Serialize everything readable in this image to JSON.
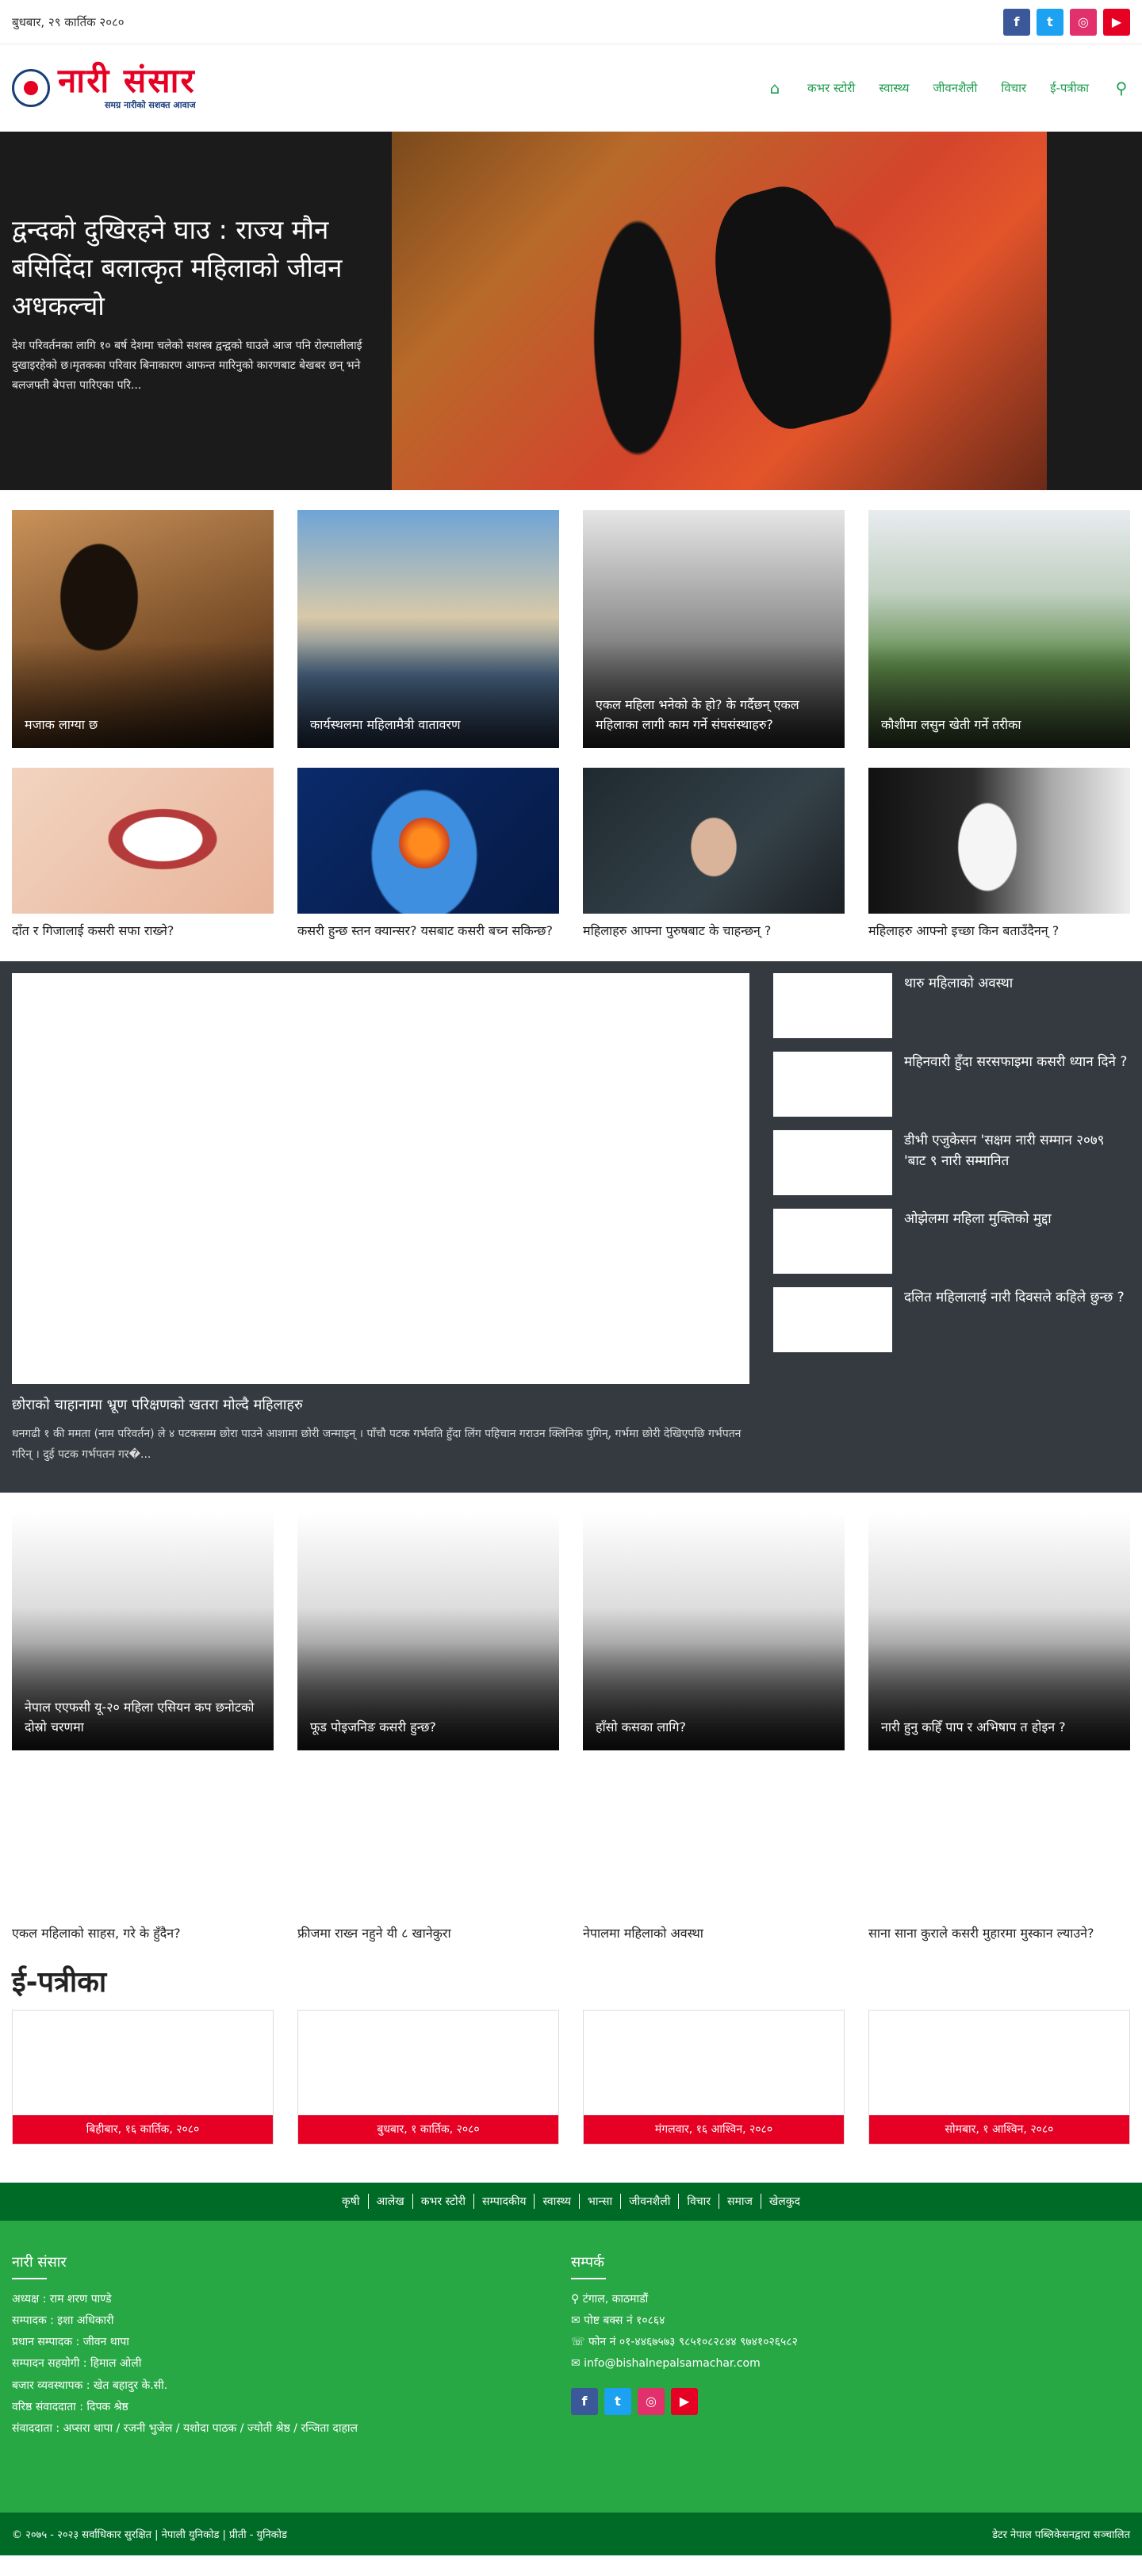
{
  "topbar": {
    "date": "बुधबार, २९ कार्तिक २०८०",
    "social": [
      "f",
      "t",
      "◎",
      "▶"
    ]
  },
  "logo": {
    "title": "नारी संसार",
    "tagline": "समग्र नारीको सशक्त आवाज"
  },
  "nav": {
    "home_icon": "⌂",
    "items": [
      "कभर स्टोरी",
      "स्वास्थ्य",
      "जीवनशैली",
      "विचार",
      "ई-पत्रीका"
    ],
    "search_icon": "⚲"
  },
  "hero": {
    "title": "द्वन्दको दुखिरहने घाउ : राज्य मौन बसिदिंदा बलात्कृत महिलाको जीवन अधकल्चो",
    "excerpt": "देश परिवर्तनका लागि १० बर्ष देशमा चलेको सशस्त्र द्वन्द्वको घाउले आज पनि रोल्पालीलाई दुखाइरहेको छ।मृतकका परिवार बिनाकारण आफन्त मारिनुको कारणबाट बेखबर छन् भने बलजफ्ती बेपत्ता पारिएका परि..."
  },
  "section1": [
    {
      "title": "मजाक लाग्या छ"
    },
    {
      "title": "कार्यस्थलमा महिलामैत्री वातावरण"
    },
    {
      "title": "एकल महिला भनेको के हो? के गर्दैछन् एकल महिलाका लागी काम गर्ने संघसंस्थाहरु?"
    },
    {
      "title": "कौशीमा लसुन खेती गर्ने तरीका"
    }
  ],
  "section2": [
    {
      "title": "दाँत र गिजालाई कसरी सफा राख्ने?"
    },
    {
      "title": "कसरी हुन्छ स्तन क्यान्सर? यसबाट कसरी बच्न सकिन्छ?"
    },
    {
      "title": "महिलाहरु आफ्ना पुरुषबाट के चाहन्छन् ?"
    },
    {
      "title": "महिलाहरु आफ्नो इच्छा किन बताउँदैनन् ?"
    }
  ],
  "feature": {
    "title": "छोराको चाहानामा भ्रूण परिक्षणको खतरा मोल्दै महिलाहरु",
    "excerpt": "धनगढी १ की ममता (नाम परिवर्तन) ले ४ पटकसम्म छोरा पाउने आशामा छोरी जन्माइन् । पाँचौ पटक गर्भवति हुँदा लिंग पहिचान गराउन क्लिनिक पुगिन्, गर्भमा छोरी देखिएपछि गर्भपतन गरिन् । दुई पटक गर्भपतन गर�...",
    "list": [
      {
        "title": "थारु महिलाको अवस्था"
      },
      {
        "title": "महिनवारी हुँदा सरसफाइमा कसरी ध्यान दिने ?"
      },
      {
        "title": "डीभी एजुकेसन 'सक्षम नारी सम्मान २०७९ 'बाट ९ नारी सम्मानित"
      },
      {
        "title": "ओझेलमा महिला मुक्तिको मुद्दा"
      },
      {
        "title": "दलित महिलालाई नारी दिवसले कहिले छुन्छ ?"
      }
    ]
  },
  "section4": [
    {
      "title": "नेपाल एएफसी यू-२० महिला एसियन कप छनोटको दोस्रो चरणमा"
    },
    {
      "title": "फूड पोइजनिङ कसरी हुन्छ?"
    },
    {
      "title": "हाँसो कसका लागि?"
    },
    {
      "title": "नारी हुनु कहिँ पाप र अभिषाप त होइन ?"
    }
  ],
  "section5": [
    {
      "title": "एकल महिलाको साहस, गरे के हुँदैन?"
    },
    {
      "title": "फ्रीजमा राख्न नहुने यी ८ खानेकुरा"
    },
    {
      "title": "नेपालमा महिलाको अवस्था"
    },
    {
      "title": "साना साना कुराले कसरी मुहारमा मुस्कान ल्याउने?"
    }
  ],
  "epatrika": {
    "heading": "ई-पत्रीका",
    "items": [
      {
        "date": "बिहीबार, १६ कार्तिक, २०८०"
      },
      {
        "date": "बुधबार, १ कार्तिक, २०८०"
      },
      {
        "date": "मंगलवार, १६ आश्विन, २०८०"
      },
      {
        "date": "सोमबार, १ आश्विन, २०८०"
      }
    ]
  },
  "footer_nav": [
    "कृषी",
    "आलेख",
    "कभर स्टोरी",
    "सम्पादकीय",
    "स्वास्थ्य",
    "भान्सा",
    "जीवनशैली",
    "विचार",
    "समाज",
    "खेलकुद"
  ],
  "footer": {
    "about_title": "नारी संसार",
    "about_lines": [
      "अध्यक्ष : राम शरण पाण्डे",
      "सम्पादक : इशा अधिकारी",
      "प्रधान सम्पादक : जीवन थापा",
      "सम्पादन सहयोगी : हिमाल ओली",
      "बजार व्यवस्थापक : खेत बहादुर के.सी.",
      "वरिष्ठ संवाददाता : दिपक श्रेष्ठ",
      "संवाददाता : अप्सरा थापा / रजनी भुजेल / यशोदा पाठक / ज्योती श्रेष्ठ / रन्जिता दाहाल"
    ],
    "contact_title": "सम्पर्क",
    "contact_lines": [
      "⚲ टंगाल, काठमाडौं",
      "✉ पोष्ट बक्स नं १०८६४",
      "☏ फोन नं ०१-४४६७५७३ ९८५१०८२८४४ ९७४१०२६५८२",
      "✉ info@bishalnepalsamachar.com"
    ],
    "social": [
      "f",
      "t",
      "◎",
      "▶"
    ]
  },
  "copyright": {
    "left": "© २०७५ - २०२३ सर्वाधिकार सुरक्षित | नेपाली युनिकोड | प्रीती - युनिकोड",
    "right": "डेटर नेपाल पब्लिकेसनद्वारा सञ्चालित"
  },
  "colors": {
    "brand_red": "#e60023",
    "nav_green": "#1f9d4e",
    "footer_green": "#28a745",
    "footer_dark": "#006b27",
    "dark_panel": "#343a40"
  }
}
